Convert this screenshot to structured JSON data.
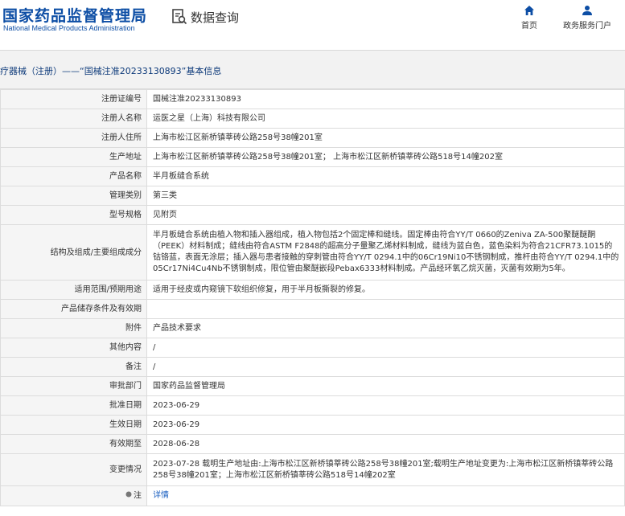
{
  "header": {
    "logo_cn": "国家药品监督管理局",
    "logo_en": "National Medical Products Administration",
    "search_label": "数据查询",
    "nav": [
      {
        "label": "首页",
        "icon": "home-icon"
      },
      {
        "label": "政务服务门户",
        "icon": "user-icon"
      }
    ]
  },
  "breadcrumb": "疗器械（注册）——“国械注准20233130893”基本信息",
  "colors": {
    "brand": "#0d4ea5",
    "label_bg": "#f5f5f5",
    "link": "#1a5fc0"
  },
  "rows": [
    {
      "label": "注册证编号",
      "value": "国械注准20233130893"
    },
    {
      "label": "注册人名称",
      "value": "运医之星（上海）科技有限公司"
    },
    {
      "label": "注册人住所",
      "value": "上海市松江区新桥镇莘砖公路258号38幢201室"
    },
    {
      "label": "生产地址",
      "value": "上海市松江区新桥镇莘砖公路258号38幢201室； 上海市松江区新桥镇莘砖公路518号14幢202室"
    },
    {
      "label": "产品名称",
      "value": "半月板缝合系统"
    },
    {
      "label": "管理类别",
      "value": "第三类"
    },
    {
      "label": "型号规格",
      "value": "见附页"
    },
    {
      "label": "结构及组成/主要组成成分",
      "value": "半月板缝合系统由植入物和插入器组成，植入物包括2个固定棒和缝线。固定棒由符合YY/T 0660的Zeniva ZA-500聚醚醚酮（PEEK）材料制成；缝线由符合ASTM F2848的超高分子量聚乙烯材料制成，缝线为蓝白色，蓝色染料为符合21CFR73.1015的钴铬蓝，表面无涂层；插入器与患者接触的穿刺管由符合YY/T 0294.1中的06Cr19Ni10不锈钢制成，推杆由符合YY/T 0294.1中的05Cr17Ni4Cu4Nb不锈钢制成，限位管由聚醚嵌段Pebax6333材料制成。产品经环氧乙烷灭菌，灭菌有效期为5年。"
    },
    {
      "label": "适用范围/预期用途",
      "value": "适用于经皮或内窥镜下软组织修复，用于半月板撕裂的修复。"
    },
    {
      "label": "产品储存条件及有效期",
      "value": ""
    },
    {
      "label": "附件",
      "value": "产品技术要求"
    },
    {
      "label": "其他内容",
      "value": "/"
    },
    {
      "label": "备注",
      "value": "/"
    },
    {
      "label": "审批部门",
      "value": "国家药品监督管理局"
    },
    {
      "label": "批准日期",
      "value": "2023-06-29"
    },
    {
      "label": "生效日期",
      "value": "2023-06-29"
    },
    {
      "label": "有效期至",
      "value": "2028-06-28"
    },
    {
      "label": "变更情况",
      "value": "2023-07-28 载明生产地址由:上海市松江区新桥镇莘砖公路258号38幢201室;载明生产地址变更为:上海市松江区新桥镇莘砖公路258号38幢201室；上海市松江区新桥镇莘砖公路518号14幢202室"
    },
    {
      "label": "注",
      "value": "详情"
    }
  ]
}
